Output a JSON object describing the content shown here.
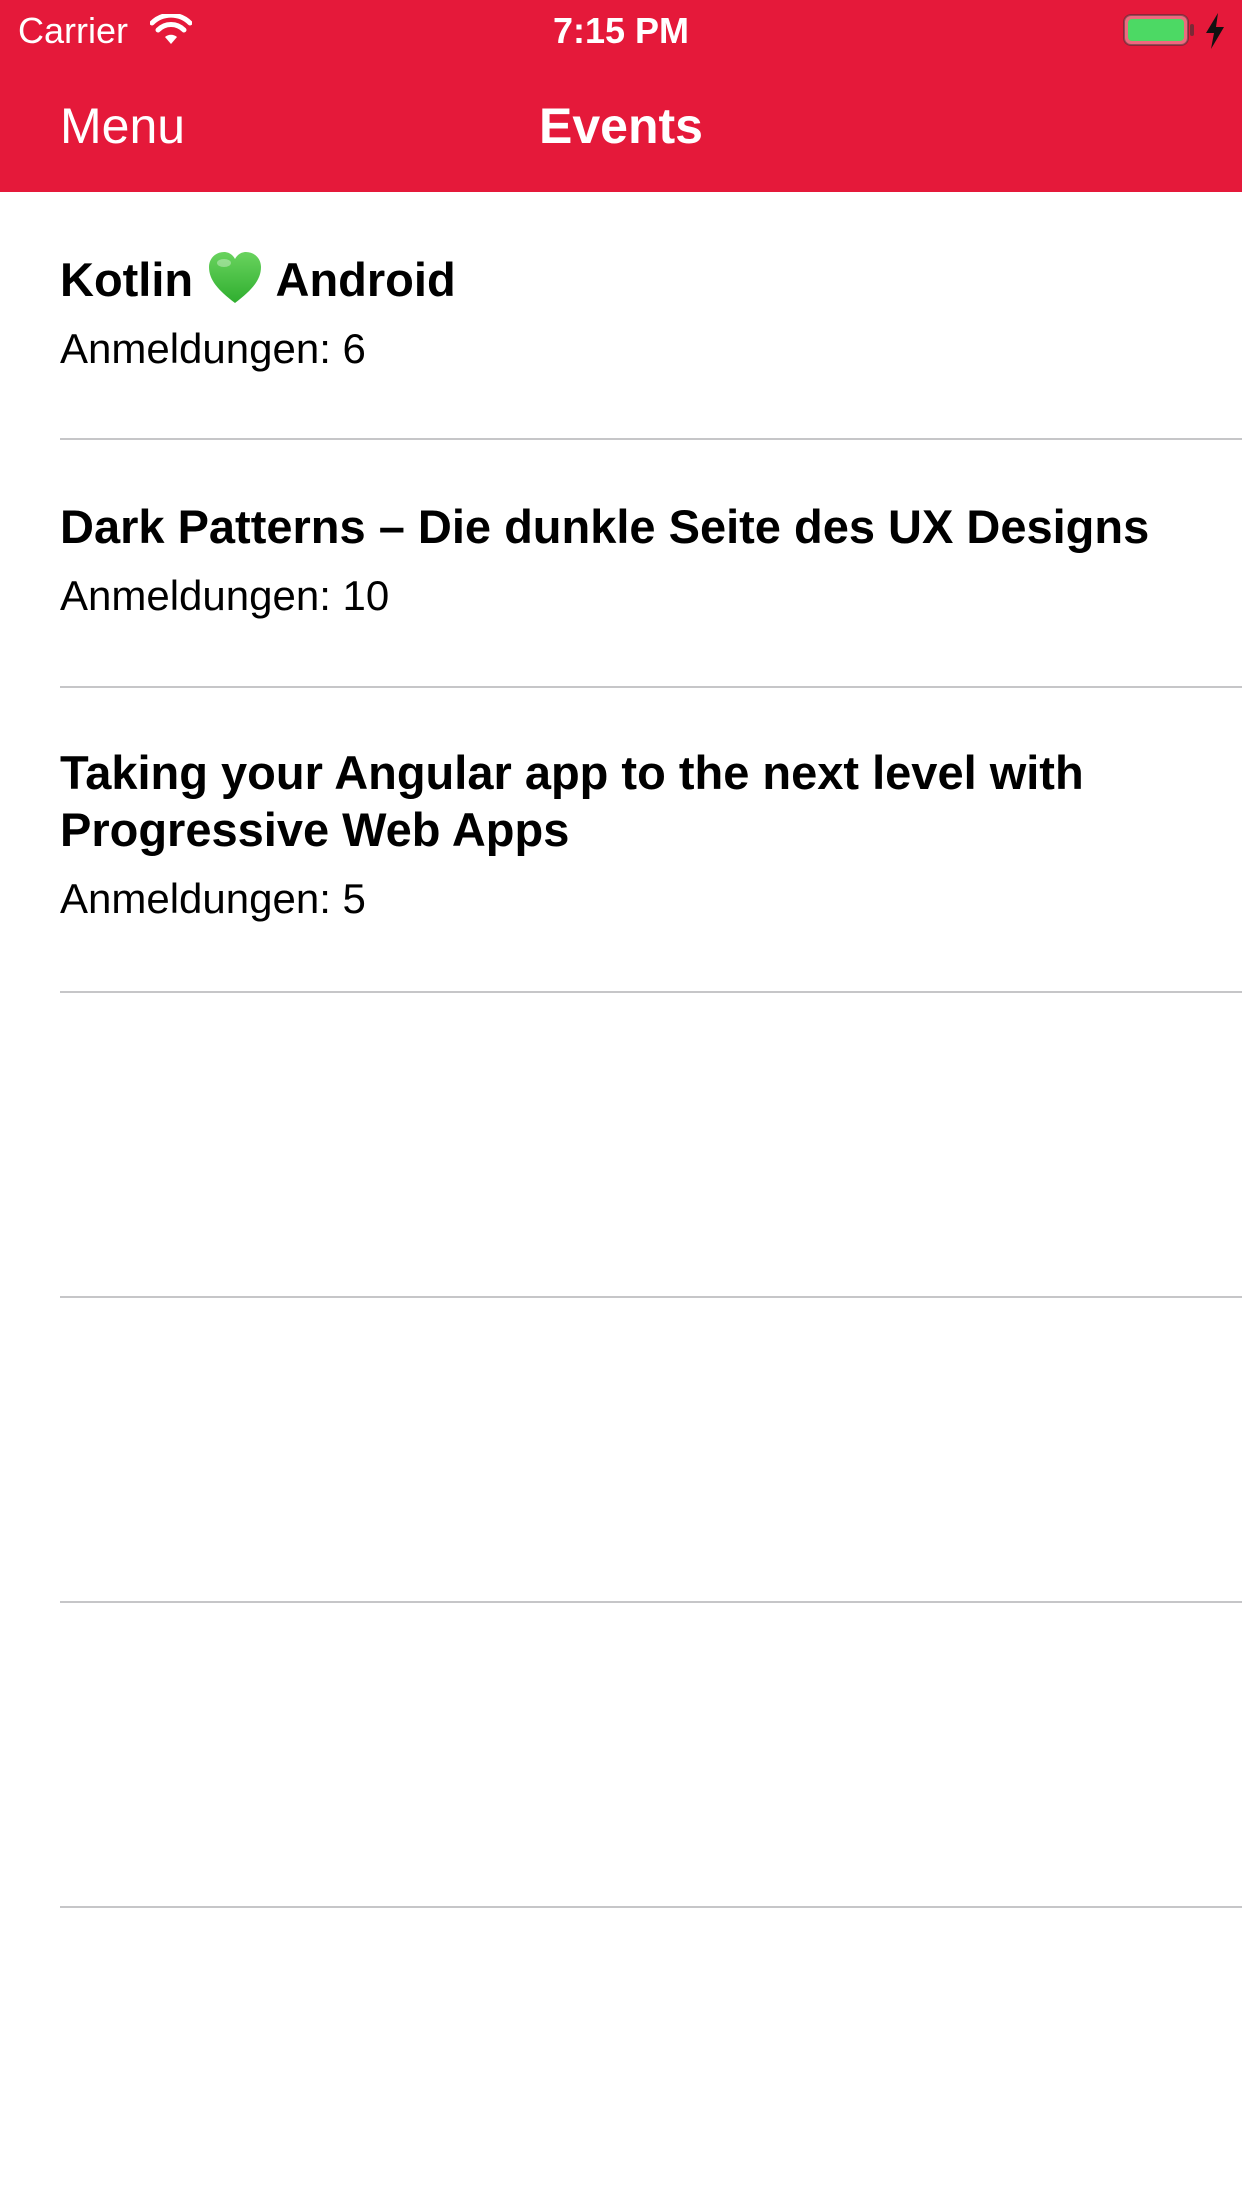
{
  "status_bar": {
    "carrier": "Carrier",
    "time": "7:15 PM",
    "wifi_icon": "wifi-icon",
    "battery_icon": "battery-icon",
    "charging_icon": "charging-bolt-icon"
  },
  "nav": {
    "menu_label": "Menu",
    "title": "Events"
  },
  "colors": {
    "header_background": "#e5193a",
    "header_text": "#ffffff",
    "battery_fill": "#4cd964",
    "heart": "#3fbf3f",
    "separator": "#c6c6c8"
  },
  "events": [
    {
      "title_before_icon": "Kotlin",
      "icon": "green-heart-icon",
      "title_after_icon": "Android",
      "registrations": "Anmeldungen: 6"
    },
    {
      "title": "Dark Patterns – Die dunkle Seite des UX Designs",
      "registrations": "Anmeldungen: 10"
    },
    {
      "title_line_1": "Taking your Angular app to the next level with",
      "title_line_2": "Progressive Web Apps",
      "registrations": "Anmeldungen: 5"
    }
  ]
}
